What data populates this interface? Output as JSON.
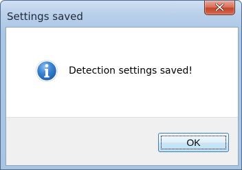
{
  "window": {
    "title": "Settings saved",
    "close_icon": "close-x-icon"
  },
  "message": {
    "icon": "info-icon",
    "text": "Detection settings saved!"
  },
  "buttons": {
    "ok_label": "OK"
  },
  "colors": {
    "titlebar_gradient_top": "#cfe0f3",
    "titlebar_gradient_bottom": "#a9c4e3",
    "close_button_red": "#c4472d",
    "info_icon_blue": "#1f5fae",
    "button_area_bg": "#f0f0f0",
    "ok_button_border": "#3c7fb1"
  }
}
